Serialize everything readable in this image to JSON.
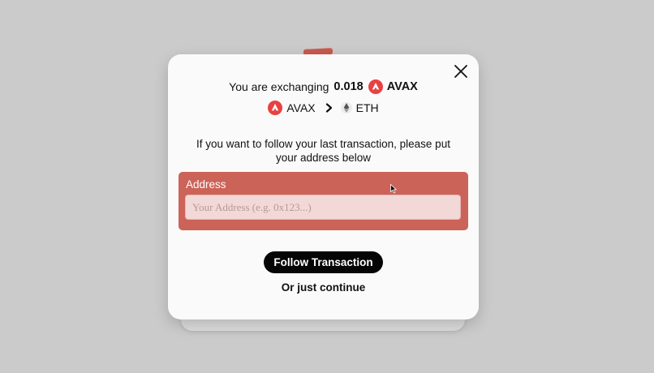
{
  "modal": {
    "exchange_prefix": "You are exchanging",
    "amount": "0.018",
    "from_token": "AVAX",
    "pair": {
      "from": "AVAX",
      "to": "ETH"
    },
    "instruction": "If you want to follow your last transaction, please put your address below",
    "address": {
      "label": "Address",
      "value": "",
      "placeholder": "Your Address (e.g. 0x123...)"
    },
    "follow_button": "Follow Transaction",
    "continue_link": "Or just continue"
  },
  "icons": {
    "close": "close-icon",
    "avax": "avax-icon",
    "eth": "eth-icon",
    "arrow": "chevron-right-icon"
  },
  "colors": {
    "accent": "#cc6358",
    "avax": "#e84142",
    "button": "#050505",
    "modal_bg": "#fafafa",
    "page_bg": "#cbcbcb"
  }
}
